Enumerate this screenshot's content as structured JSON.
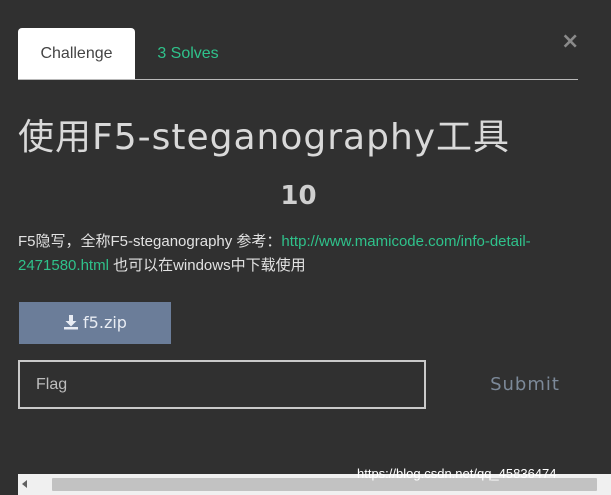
{
  "modal": {
    "close_glyph": "×",
    "tabs": [
      {
        "label": "Challenge",
        "active": true
      },
      {
        "label": "3 Solves",
        "active": false
      }
    ],
    "title": "使用F5-steganography工具",
    "points": "10",
    "description": {
      "text_before": "F5隐写，全称F5-steganography 参考：",
      "link": "http://www.mamicode.com/info-detail-2471580.html",
      "text_after": " 也可以在windows中下载使用"
    },
    "file_button": {
      "icon": "download-icon",
      "label": "f5.zip"
    },
    "flag_input": {
      "placeholder": "Flag",
      "value": ""
    },
    "submit_label": "Submit"
  },
  "watermark": "https://blog.csdn.net/qq_45836474",
  "colors": {
    "background": "#303030",
    "accent_green": "#2fc28b",
    "file_button": "#6b7d99",
    "submit_text": "#7c8999"
  }
}
